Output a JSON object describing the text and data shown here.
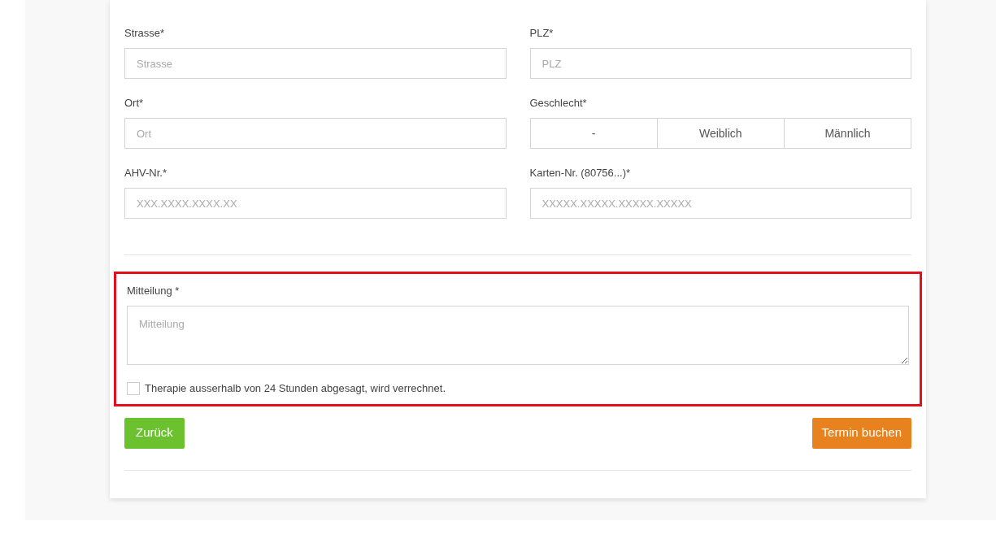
{
  "fields_left": [
    {
      "label": "Strasse*",
      "placeholder": "Strasse"
    },
    {
      "label": "Ort*",
      "placeholder": "Ort"
    },
    {
      "label": "AHV-Nr.*",
      "placeholder": "XXX.XXXX.XXXX.XX"
    }
  ],
  "fields_right": [
    {
      "label": "PLZ*",
      "kind": "input",
      "placeholder": "PLZ"
    },
    {
      "label": "Geschlecht*",
      "kind": "segmented",
      "options": [
        {
          "label": "-",
          "selected": false
        },
        {
          "label": "Weiblich",
          "selected": false
        },
        {
          "label": "Männlich",
          "selected": false
        }
      ]
    },
    {
      "label": "Karten-Nr. (80756...)*",
      "kind": "input",
      "placeholder": "XXXXX.XXXXX.XXXXX.XXXXX"
    }
  ],
  "message": {
    "highlighted": true,
    "label": "Mitteilung *",
    "placeholder": "Mitteilung",
    "checkbox": {
      "label": "Therapie ausserhalb von 24 Stunden abgesagt, wird verrechnet.",
      "checked": false
    }
  },
  "buttons": {
    "back": "Zurück",
    "submit": "Termin buchen"
  }
}
